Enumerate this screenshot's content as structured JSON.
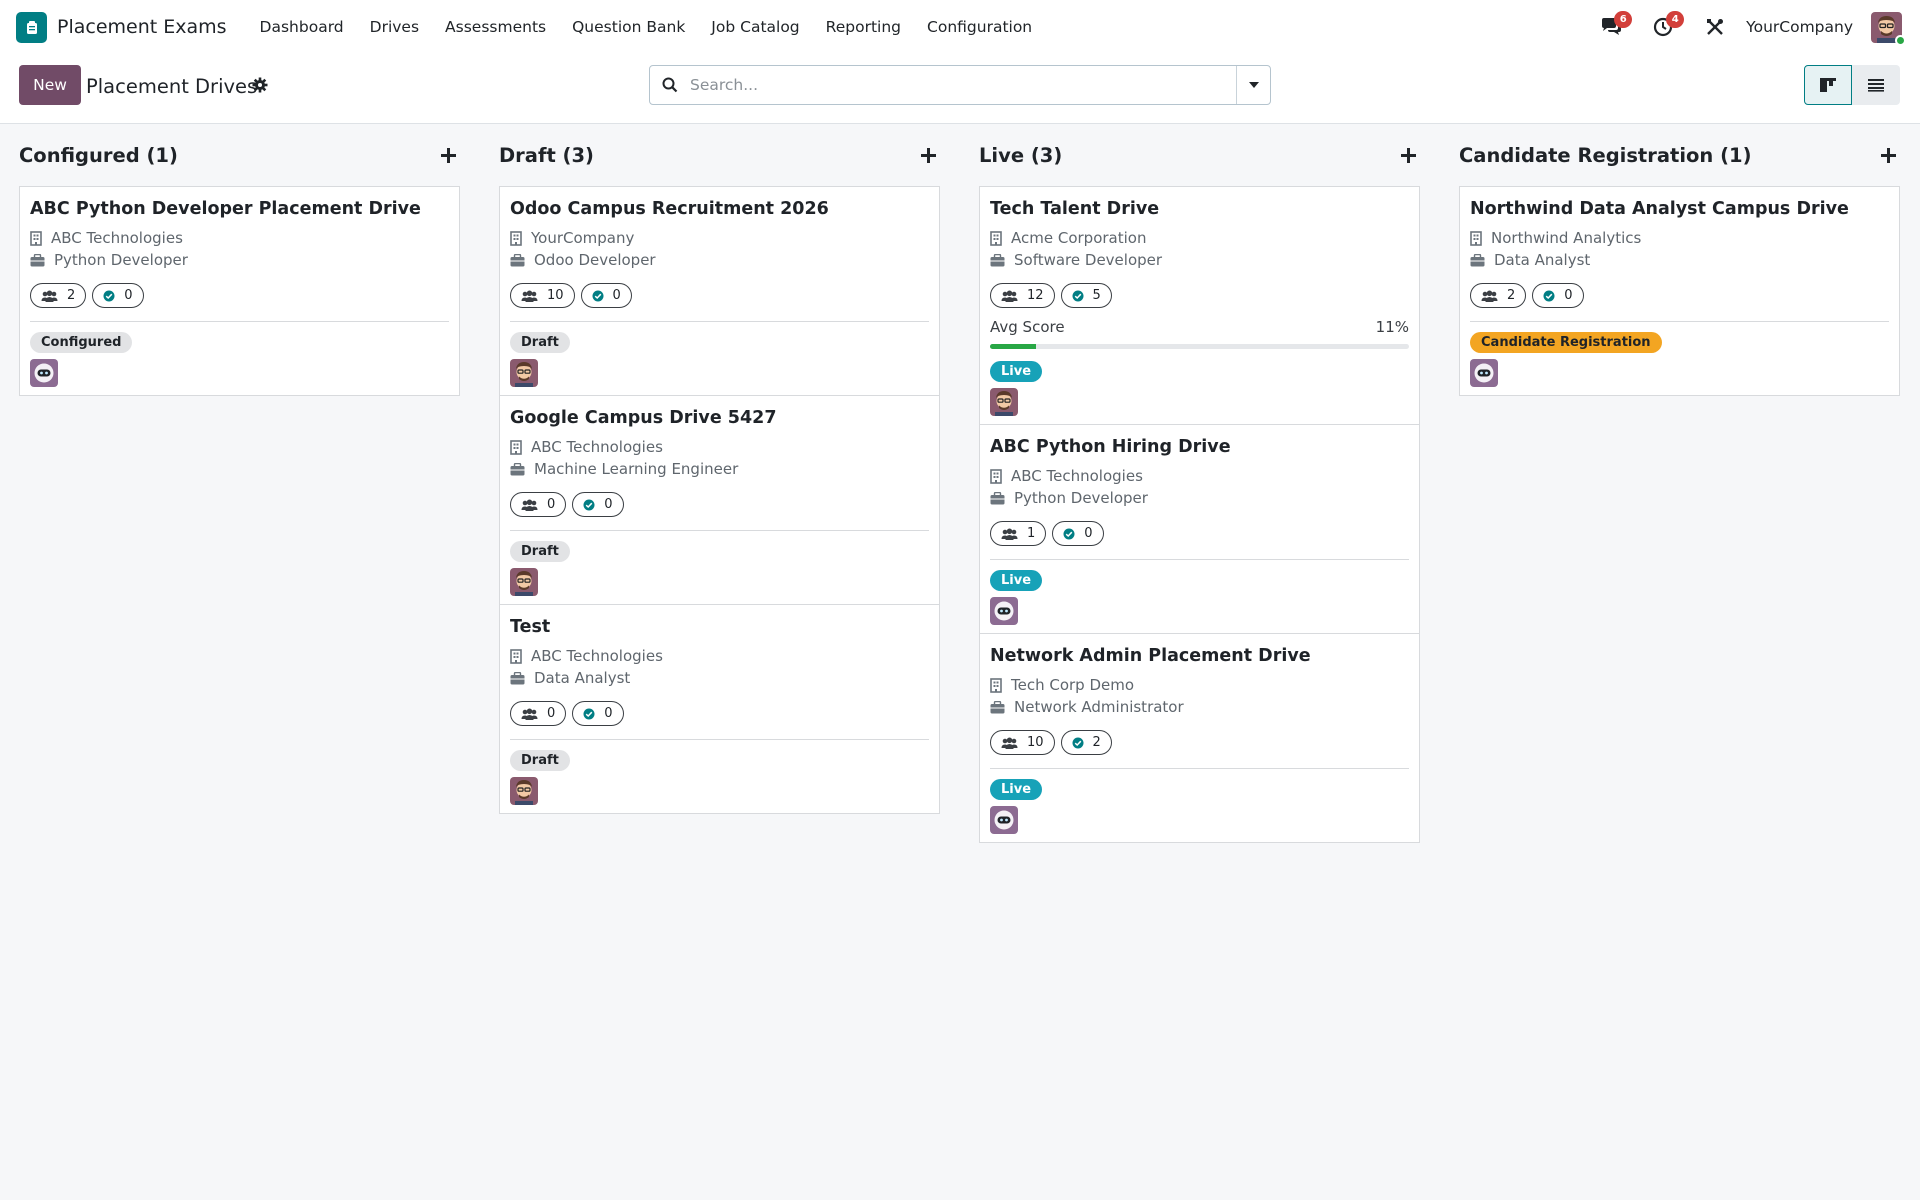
{
  "app": {
    "name": "Placement Exams",
    "menu": [
      "Dashboard",
      "Drives",
      "Assessments",
      "Question Bank",
      "Job Catalog",
      "Reporting",
      "Configuration"
    ],
    "messages_count": "6",
    "activities_count": "4",
    "company": "YourCompany"
  },
  "control": {
    "new_label": "New",
    "title": "Placement Drives",
    "search_placeholder": "Search..."
  },
  "colors": {
    "brand": "#017e84",
    "primary_button": "#714b67",
    "live": "#17a2b8",
    "candidate_registration": "#f3a522",
    "progress": "#28a745"
  },
  "columns": [
    {
      "title": "Configured (1)",
      "cards": [
        {
          "title": "ABC Python Developer Placement Drive",
          "company": "ABC Technologies",
          "job": "Python Developer",
          "candidates": "2",
          "completed": "0",
          "status": "Configured",
          "avatar": "robot"
        }
      ]
    },
    {
      "title": "Draft (3)",
      "cards": [
        {
          "title": "Odoo Campus Recruitment 2026",
          "company": "YourCompany",
          "job": "Odoo Developer",
          "candidates": "10",
          "completed": "0",
          "status": "Draft",
          "avatar": "person"
        },
        {
          "title": "Google Campus Drive 5427",
          "company": "ABC Technologies",
          "job": "Machine Learning Engineer",
          "candidates": "0",
          "completed": "0",
          "status": "Draft",
          "avatar": "person"
        },
        {
          "title": "Test",
          "company": "ABC Technologies",
          "job": "Data Analyst",
          "candidates": "0",
          "completed": "0",
          "status": "Draft",
          "avatar": "person"
        }
      ]
    },
    {
      "title": "Live (3)",
      "cards": [
        {
          "title": "Tech Talent Drive",
          "company": "Acme Corporation",
          "job": "Software Developer",
          "candidates": "12",
          "completed": "5",
          "score_label": "Avg Score",
          "score_text": "11%",
          "score_value": 11,
          "status": "Live",
          "avatar": "person"
        },
        {
          "title": "ABC Python Hiring Drive",
          "company": "ABC Technologies",
          "job": "Python Developer",
          "candidates": "1",
          "completed": "0",
          "status": "Live",
          "avatar": "robot"
        },
        {
          "title": "Network Admin Placement Drive",
          "company": "Tech Corp Demo",
          "job": "Network Administrator",
          "candidates": "10",
          "completed": "2",
          "status": "Live",
          "avatar": "robot"
        }
      ]
    },
    {
      "title": "Candidate Registration (1)",
      "cards": [
        {
          "title": "Northwind Data Analyst Campus Drive",
          "company": "Northwind Analytics",
          "job": "Data Analyst",
          "candidates": "2",
          "completed": "0",
          "status": "Candidate Registration",
          "avatar": "robot"
        }
      ]
    }
  ]
}
